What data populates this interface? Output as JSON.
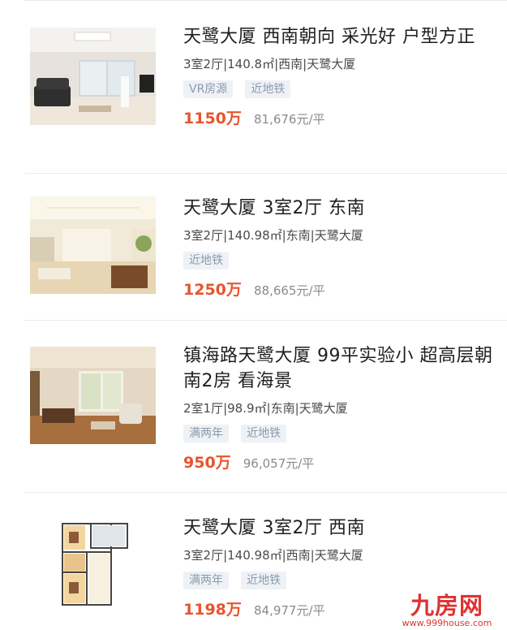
{
  "listings": [
    {
      "title": "天鹭大厦 西南朝向 采光好 户型方正",
      "meta": "3室2厅|140.8㎡|西南|天鹭大厦",
      "tags": [
        "VR房源",
        "近地铁"
      ],
      "price": "1150万",
      "unit_price": "81,676元/平",
      "photo": "living-room-photo"
    },
    {
      "title": "天鹭大厦 3室2厅 东南",
      "meta": "3室2厅|140.98㎡|东南|天鹭大厦",
      "tags": [
        "近地铁"
      ],
      "price": "1250万",
      "unit_price": "88,665元/平",
      "photo": "living-room-photo"
    },
    {
      "title": "镇海路天鹭大厦 99平实验小 超高层朝南2房 看海景",
      "meta": "2室1厅|98.9㎡|东南|天鹭大厦",
      "tags": [
        "满两年",
        "近地铁"
      ],
      "price": "950万",
      "unit_price": "96,057元/平",
      "photo": "living-room-photo"
    },
    {
      "title": "天鹭大厦 3室2厅 西南",
      "meta": "3室2厅|140.98㎡|西南|天鹭大厦",
      "tags": [
        "满两年",
        "近地铁"
      ],
      "price": "1198万",
      "unit_price": "84,977元/平",
      "photo": "floor-plan"
    }
  ],
  "watermark": {
    "logo": "九房网",
    "url": "www.999house.com"
  },
  "colors": {
    "price": "#e8542d",
    "tag_bg": "#eef2f6",
    "tag_text": "#8a9bab"
  }
}
